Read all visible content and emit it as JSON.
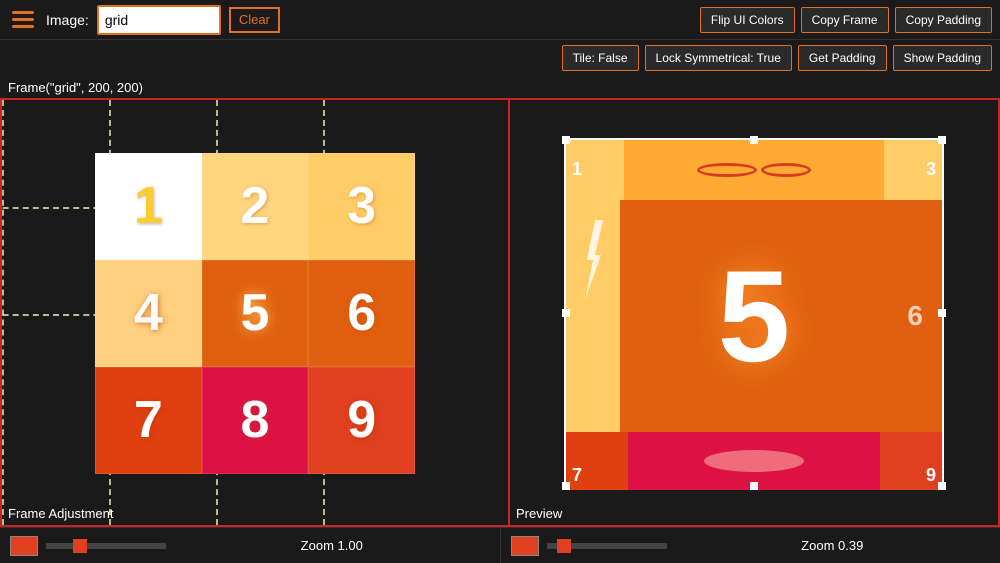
{
  "header": {
    "hamburger_label": "menu",
    "image_label": "Image:",
    "image_value": "grid",
    "clear_label": "Clear",
    "buttons_row1": [
      {
        "id": "flip-ui",
        "label": "Flip UI Colors"
      },
      {
        "id": "copy-frame",
        "label": "Copy Frame"
      },
      {
        "id": "copy-padding",
        "label": "Copy Padding"
      }
    ],
    "buttons_row2": [
      {
        "id": "tile-false",
        "label": "Tile: False"
      },
      {
        "id": "lock-sym",
        "label": "Lock Symmetrical: True"
      }
    ],
    "buttons_row3": [
      {
        "id": "get-padding",
        "label": "Get Padding"
      },
      {
        "id": "show-padding",
        "label": "Show Padding"
      }
    ]
  },
  "frame_info": {
    "text": "Frame(\"grid\", 200, 200)"
  },
  "left_panel": {
    "label": "Frame Adjustment",
    "cells": [
      {
        "num": "1",
        "color": "#ffffff"
      },
      {
        "num": "2",
        "color": "#ffd580"
      },
      {
        "num": "3",
        "color": "#ffcc66"
      },
      {
        "num": "4",
        "color": "#ffd080"
      },
      {
        "num": "5",
        "color": "#e06010"
      },
      {
        "num": "6",
        "color": "#e06010"
      },
      {
        "num": "7",
        "color": "#e04010"
      },
      {
        "num": "8",
        "color": "#dd1144"
      },
      {
        "num": "9",
        "color": "#e04020"
      }
    ],
    "zoom_label": "Zoom 1.00"
  },
  "right_panel": {
    "label": "Preview",
    "cells": {
      "top_left_num": "1",
      "top_right_num": "3",
      "mid_num": "5",
      "mid_right_num": "6",
      "bot_left_num": "7",
      "bot_right_num": "9"
    },
    "zoom_label": "Zoom 0.39"
  }
}
